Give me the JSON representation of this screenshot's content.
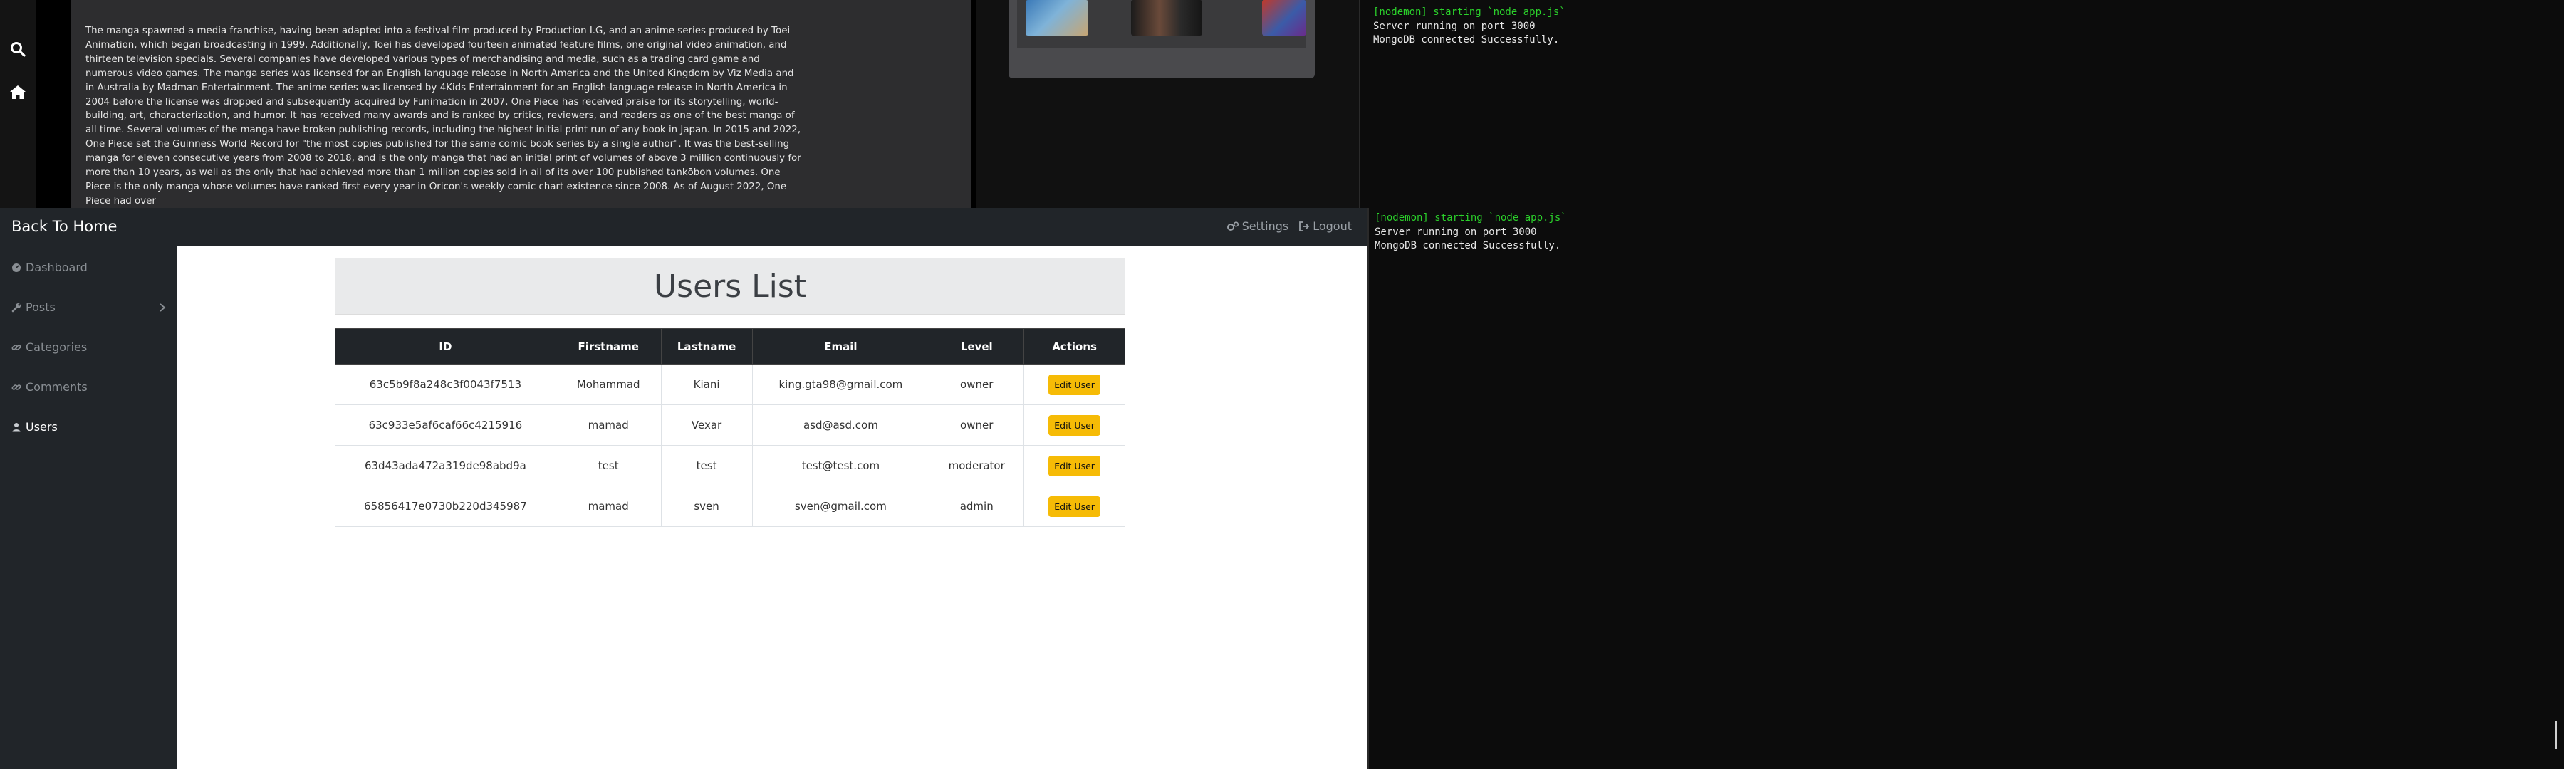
{
  "blog": {
    "paragraph": "The manga spawned a media franchise, having been adapted into a festival film produced by Production I.G, and an anime series produced by Toei Animation, which began broadcasting in 1999. Additionally, Toei has developed fourteen animated feature films, one original video animation, and thirteen television specials. Several companies have developed various types of merchandising and media, such as a trading card game and numerous video games. The manga series was licensed for an English language release in North America and the United Kingdom by Viz Media and in Australia by Madman Entertainment. The anime series was licensed by 4Kids Entertainment for an English-language release in North America in 2004 before the license was dropped and subsequently acquired by Funimation in 2007. One Piece has received praise for its storytelling, world-building, art, characterization, and humor. It has received many awards and is ranked by critics, reviewers, and readers as one of the best manga of all time. Several volumes of the manga have broken publishing records, including the highest initial print run of any book in Japan. In 2015 and 2022, One Piece set the Guinness World Record for \"the most copies published for the same comic book series by a single author\". It was the best-selling manga for eleven consecutive years from 2008 to 2018, and is the only manga that had an initial print of volumes of above 3 million continuously for more than 10 years, as well as the only that had achieved more than 1 million copies sold in all of its over 100 published tankōbon volumes. One Piece is the only manga whose volumes have ranked first every year in Oricon's weekly comic chart existence since 2008. As of August 2022, One Piece had over",
    "icons": [
      "search-icon",
      "home-icon"
    ]
  },
  "terminal_top": {
    "lines": [
      "[nodemon] starting `node app.js`",
      "Server running on port 3000",
      "MongoDB connected Successfully."
    ]
  },
  "terminal_bottom": {
    "lines": [
      "[nodemon] starting `node app.js`",
      "Server running on port 3000",
      "MongoDB connected Successfully."
    ]
  },
  "admin": {
    "brand": "Back To Home",
    "settings_label": "Settings",
    "logout_label": "Logout",
    "sidebar": [
      {
        "label": "Dashboard",
        "icon": "dashboard-icon"
      },
      {
        "label": "Posts",
        "icon": "wrench-icon"
      },
      {
        "label": "Categories",
        "icon": "link-icon"
      },
      {
        "label": "Comments",
        "icon": "link-icon"
      },
      {
        "label": "Users",
        "icon": "user-icon",
        "active": true
      }
    ],
    "page_title": "Users List",
    "table": {
      "headers": [
        "ID",
        "Firstname",
        "Lastname",
        "Email",
        "Level",
        "Actions"
      ],
      "edit_label": "Edit User",
      "rows": [
        {
          "id": "63c5b9f8a248c3f0043f7513",
          "firstname": "Mohammad",
          "lastname": "Kiani",
          "email": "king.gta98@gmail.com",
          "level": "owner"
        },
        {
          "id": "63c933e5af6caf66c4215916",
          "firstname": "mamad",
          "lastname": "Vexar",
          "email": "asd@asd.com",
          "level": "owner"
        },
        {
          "id": "63d43ada472a319de98abd9a",
          "firstname": "test",
          "lastname": "test",
          "email": "test@test.com",
          "level": "moderator"
        },
        {
          "id": "65856417e0730b220d345987",
          "firstname": "mamad",
          "lastname": "sven",
          "email": "sven@gmail.com",
          "level": "admin"
        }
      ]
    },
    "colors": {
      "dark": "#212529",
      "edit_button": "#f6bb06",
      "terminal_green": "#2bd12b"
    }
  }
}
